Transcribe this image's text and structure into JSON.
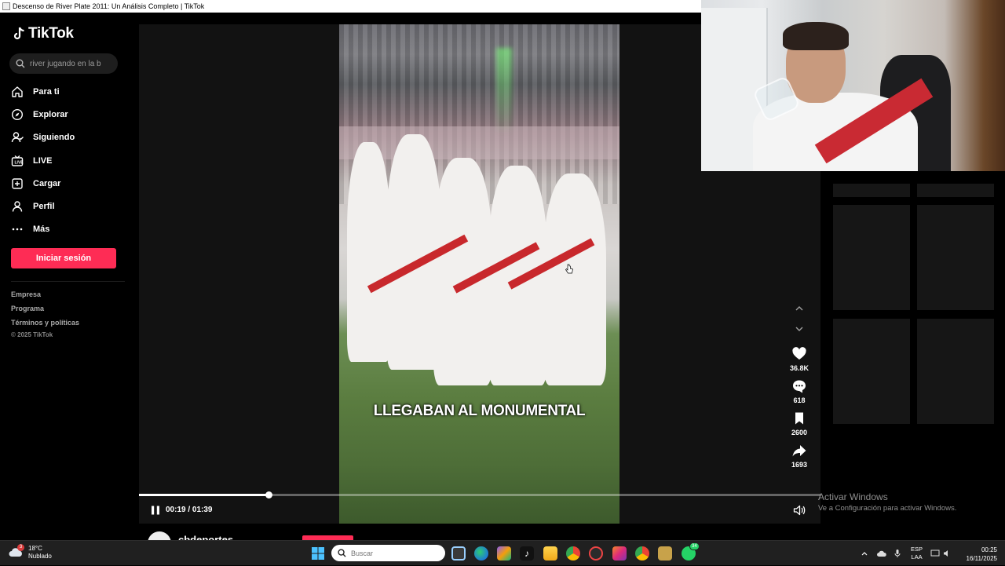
{
  "window": {
    "title": "Descenso de River Plate 2011: Un Análisis Completo | TikTok"
  },
  "sidebar": {
    "logo": "TikTok",
    "search_value": "river jugando en la b",
    "nav": [
      {
        "label": "Para ti",
        "icon": "home-icon"
      },
      {
        "label": "Explorar",
        "icon": "compass-icon"
      },
      {
        "label": "Siguiendo",
        "icon": "following-icon"
      },
      {
        "label": "LIVE",
        "icon": "live-icon"
      },
      {
        "label": "Cargar",
        "icon": "upload-icon"
      },
      {
        "label": "Perfil",
        "icon": "profile-icon"
      },
      {
        "label": "Más",
        "icon": "more-icon"
      }
    ],
    "login_label": "Iniciar sesión",
    "footer_links": [
      "Empresa",
      "Programa",
      "Términos y políticas"
    ],
    "copyright": "© 2025 TikTok"
  },
  "player": {
    "caption": "LLEGABAN AL MONUMENTAL",
    "time": "00:19 / 01:39",
    "progress": 0.19,
    "actions": {
      "likes": "36.8K",
      "comments": "618",
      "saves": "2600",
      "shares": "1693"
    },
    "author": "cbdeportes"
  },
  "watermark": {
    "line1": "Activar Windows",
    "line2": "Ve a Configuración para activar Windows."
  },
  "taskbar": {
    "weather_temp": "18°C",
    "weather_desc": "Nublado",
    "weather_badge": "3",
    "search_placeholder": "Buscar",
    "whatsapp_badge": "34",
    "lang_1": "ESP",
    "lang_2": "LAA",
    "time": "00:25",
    "date": "16/11/2025"
  },
  "colors": {
    "accent": "#fe2c55",
    "background": "#000000",
    "player_bg": "#121212"
  }
}
